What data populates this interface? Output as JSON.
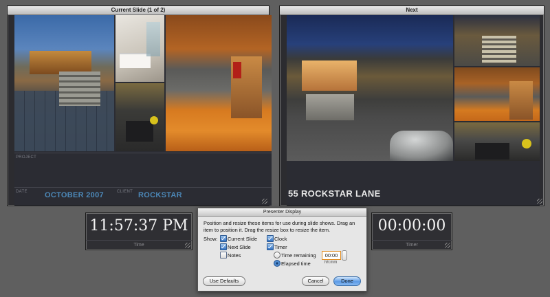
{
  "current_panel": {
    "title": "Current Slide (1 of 2)"
  },
  "next_panel": {
    "title": "Next"
  },
  "current_slide": {
    "project_label": "PROJECT",
    "date_label": "DATE",
    "date_value": "OCTOBER 2007",
    "client_label": "CLIENT",
    "client_value": "ROCKSTAR"
  },
  "next_slide": {
    "caption": "55 ROCKSTAR LANE"
  },
  "clock": {
    "time": "11:57:37 PM",
    "label": "Time"
  },
  "timer": {
    "time": "00:00:00",
    "label": "Timer"
  },
  "dialog": {
    "title": "Presenter Display",
    "description": "Position and resize these items for use during slide shows. Drag an item to position it. Drag the resize box to resize the item.",
    "show_label": "Show:",
    "options": {
      "current_slide": {
        "label": "Current Slide",
        "checked": true
      },
      "next_slide": {
        "label": "Next Slide",
        "checked": true
      },
      "notes": {
        "label": "Notes",
        "checked": false
      },
      "clock": {
        "label": "Clock",
        "checked": true
      },
      "timer": {
        "label": "Timer",
        "checked": true
      }
    },
    "timer_mode": {
      "time_remaining_label": "Time remaining",
      "elapsed_label": "Elapsed time",
      "selected": "elapsed",
      "time_value": "00:00",
      "time_format": "hh:mm"
    },
    "buttons": {
      "defaults": "Use Defaults",
      "cancel": "Cancel",
      "done": "Done"
    }
  },
  "colors": {
    "accent_text": "#4c88b8",
    "background": "#5f5f5f",
    "slide_bg": "#2b2c33"
  }
}
